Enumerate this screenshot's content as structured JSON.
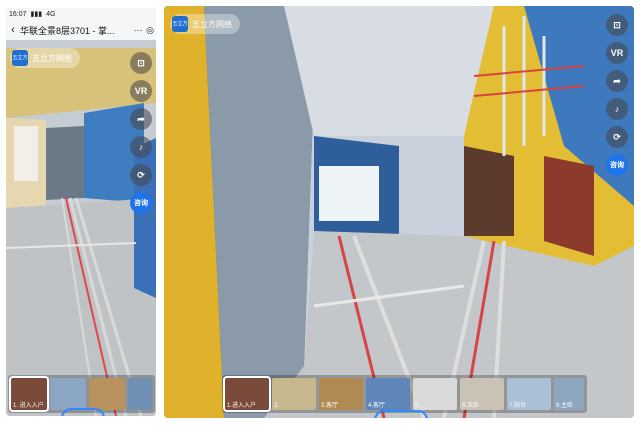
{
  "phone": {
    "status": {
      "time": "16:07",
      "signal": "4G"
    },
    "title": "华联全景8层3701 - 掌...",
    "brand": {
      "logo_text": "五立方",
      "name": "五立方网络"
    },
    "side_buttons": [
      {
        "icon": "frame-icon",
        "label": ""
      },
      {
        "icon": "vr-icon",
        "label": "VR"
      },
      {
        "icon": "share-icon",
        "label": ""
      },
      {
        "icon": "music-icon",
        "label": ""
      },
      {
        "icon": "gyro-icon",
        "label": ""
      },
      {
        "icon": "consult-icon",
        "label": "咨询"
      }
    ],
    "thumbs": [
      {
        "label": "1. 进入入户",
        "color": "#7a4a3a"
      },
      {
        "label": "",
        "color": "#8aa6c2"
      },
      {
        "label": "",
        "color": "#b9925f"
      },
      {
        "label": "",
        "color": "#6f8fb3"
      }
    ]
  },
  "wide": {
    "brand": {
      "logo_text": "五立方",
      "name": "五立方网络"
    },
    "side_buttons": [
      {
        "icon": "frame-icon",
        "label": ""
      },
      {
        "icon": "vr-icon",
        "label": "VR"
      },
      {
        "icon": "share-icon",
        "label": ""
      },
      {
        "icon": "music-icon",
        "label": ""
      },
      {
        "icon": "gyro-icon",
        "label": ""
      },
      {
        "icon": "consult-icon",
        "label": "咨询"
      }
    ],
    "thumbs": [
      {
        "label": "1.进入入户",
        "color": "#7a4a3a"
      },
      {
        "label": "2.",
        "color": "#c7b78f"
      },
      {
        "label": "3.客厅",
        "color": "#b08a52"
      },
      {
        "label": "4.客厅",
        "color": "#5f86b8"
      },
      {
        "label": "5.",
        "color": "#d9d9d9"
      },
      {
        "label": "6.次卧",
        "color": "#c9c2b5"
      },
      {
        "label": "7.阳台",
        "color": "#a9c0d6"
      },
      {
        "label": "8.主卧",
        "color": "#8ea6bf"
      }
    ]
  },
  "colors": {
    "accent": "#1e74e8",
    "wall_blue": "#3f7fc0",
    "wall_yellow": "#e2b82c"
  }
}
